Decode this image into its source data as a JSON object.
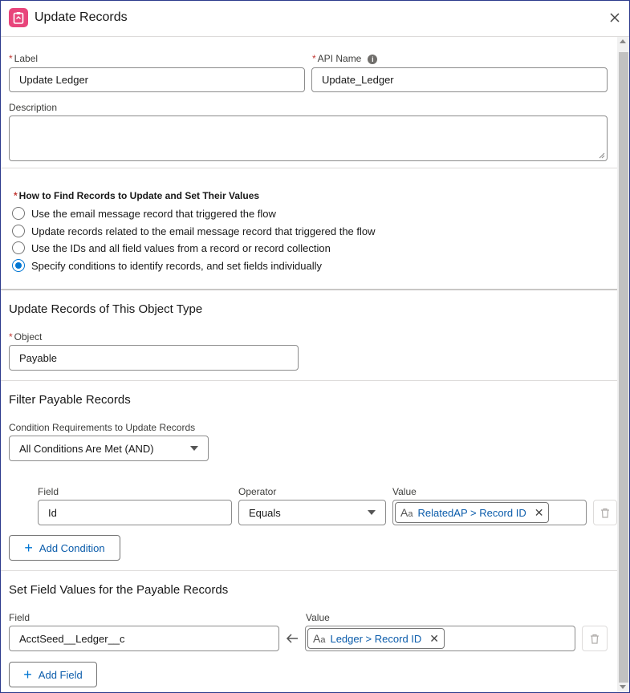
{
  "modal": {
    "title": "Update Records",
    "close_icon": "close-icon"
  },
  "form": {
    "label_label": "Label",
    "label_value": "Update Ledger",
    "api_name_label": "API Name",
    "api_name_value": "Update_Ledger",
    "description_label": "Description",
    "description_value": ""
  },
  "how_to": {
    "heading": "How to Find Records to Update and Set Their Values",
    "options": [
      {
        "label": "Use the email message record that triggered the flow",
        "checked": false
      },
      {
        "label": "Update records related to the email message record that triggered the flow",
        "checked": false
      },
      {
        "label": "Use the IDs and all field values from a record or record collection",
        "checked": false
      },
      {
        "label": "Specify conditions to identify records, and set fields individually",
        "checked": true
      }
    ]
  },
  "object_section": {
    "title": "Update Records of This Object Type",
    "object_label": "Object",
    "object_value": "Payable"
  },
  "filter_section": {
    "title": "Filter Payable Records",
    "condition_label": "Condition Requirements to Update Records",
    "condition_value": "All Conditions Are Met (AND)",
    "field_header": "Field",
    "operator_header": "Operator",
    "value_header": "Value",
    "row": {
      "field": "Id",
      "operator": "Equals",
      "value": "RelatedAP > Record ID"
    },
    "add_condition": "Add Condition"
  },
  "set_section": {
    "title": "Set Field Values for the Payable Records",
    "field_header": "Field",
    "value_header": "Value",
    "row": {
      "field": "AcctSeed__Ledger__c",
      "value": "Ledger > Record ID"
    },
    "add_field": "Add Field"
  },
  "colors": {
    "brand": "#0176d3",
    "link": "#0b5cab",
    "app_icon": "#e8457b",
    "required": "#c23934"
  }
}
